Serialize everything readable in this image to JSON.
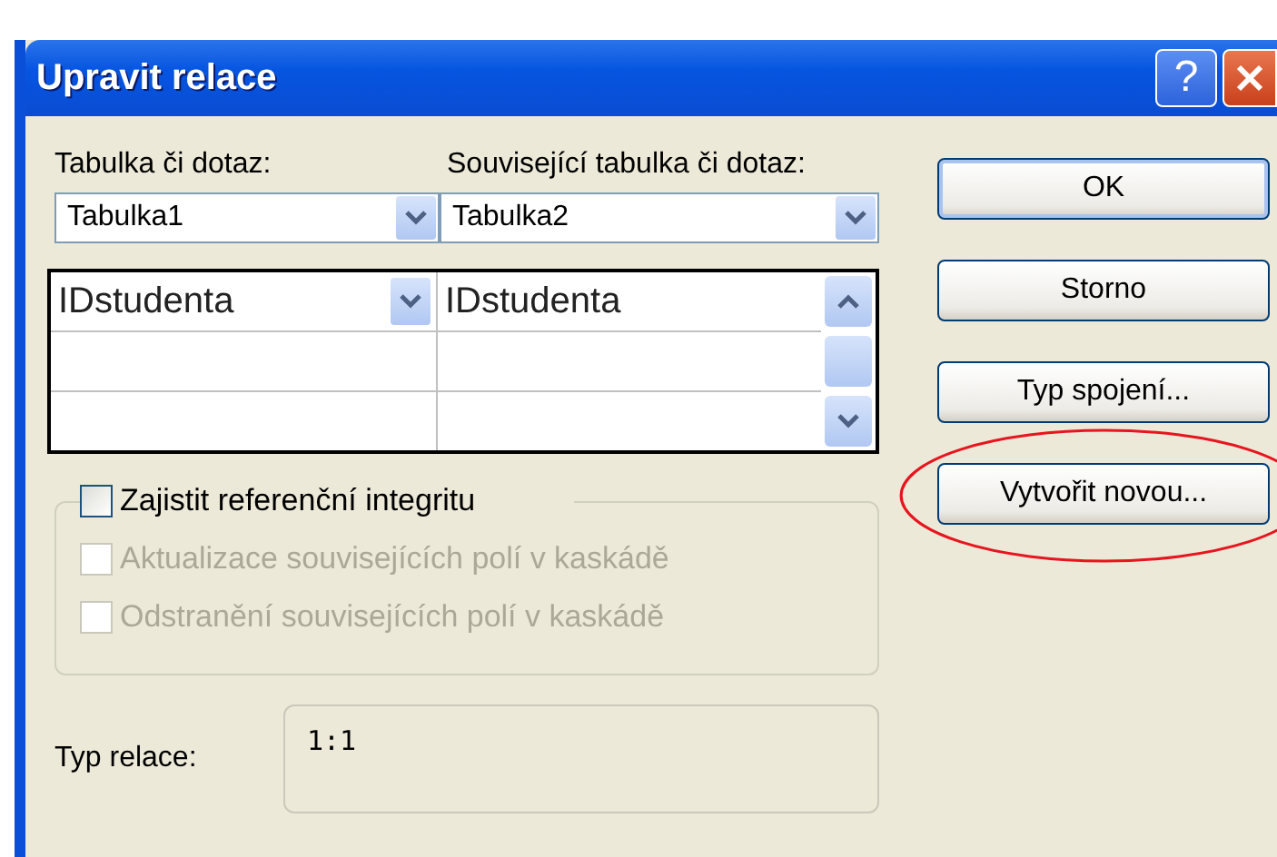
{
  "window": {
    "title": "Upravit relace",
    "buttons": [
      {
        "kind": "help",
        "label": "?"
      },
      {
        "kind": "close"
      }
    ]
  },
  "table_label": "Tabulka či dotaz:",
  "related_label": "Související tabulka či dotaz:",
  "table_combo": {
    "value": "Tabulka1"
  },
  "related_combo": {
    "value": "Tabulka2"
  },
  "field_grid": {
    "rows": [
      {
        "left": "IDstudenta",
        "right": "IDstudenta",
        "active": true
      },
      {
        "active": false
      },
      {
        "active": false
      }
    ]
  },
  "options": [
    {
      "label": "Zajistit referenční integritu",
      "checked": false,
      "disabled": false
    },
    {
      "label": "Aktualizace souvisejících polí v kaskádě",
      "checked": false,
      "disabled": true
    },
    {
      "label": "Odstranění souvisejících polí v kaskádě",
      "checked": false,
      "disabled": true
    }
  ],
  "relation_type": {
    "label": "Typ relace:",
    "value": "1:1"
  },
  "actions": [
    {
      "label": "OK",
      "default": true,
      "highlighted": false
    },
    {
      "label": "Storno",
      "default": false,
      "highlighted": false
    },
    {
      "label": "Typ spojení...",
      "default": false,
      "highlighted": false
    },
    {
      "label": "Vytvořit novou...",
      "default": false,
      "highlighted": true
    }
  ]
}
